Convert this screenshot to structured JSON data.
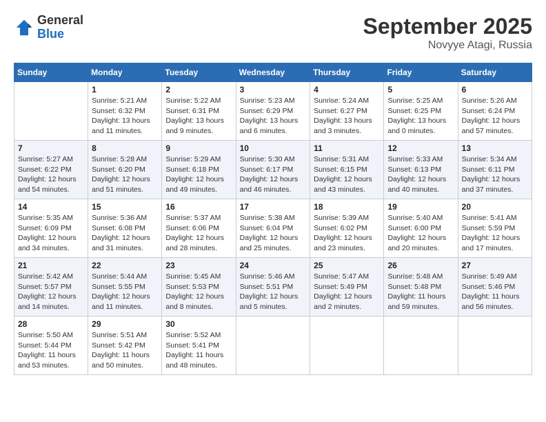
{
  "header": {
    "logo": {
      "general": "General",
      "blue": "Blue"
    },
    "title": "September 2025",
    "location": "Novyye Atagi, Russia"
  },
  "columns": [
    "Sunday",
    "Monday",
    "Tuesday",
    "Wednesday",
    "Thursday",
    "Friday",
    "Saturday"
  ],
  "weeks": [
    [
      {
        "num": "",
        "info": ""
      },
      {
        "num": "1",
        "info": "Sunrise: 5:21 AM\nSunset: 6:32 PM\nDaylight: 13 hours\nand 11 minutes."
      },
      {
        "num": "2",
        "info": "Sunrise: 5:22 AM\nSunset: 6:31 PM\nDaylight: 13 hours\nand 9 minutes."
      },
      {
        "num": "3",
        "info": "Sunrise: 5:23 AM\nSunset: 6:29 PM\nDaylight: 13 hours\nand 6 minutes."
      },
      {
        "num": "4",
        "info": "Sunrise: 5:24 AM\nSunset: 6:27 PM\nDaylight: 13 hours\nand 3 minutes."
      },
      {
        "num": "5",
        "info": "Sunrise: 5:25 AM\nSunset: 6:25 PM\nDaylight: 13 hours\nand 0 minutes."
      },
      {
        "num": "6",
        "info": "Sunrise: 5:26 AM\nSunset: 6:24 PM\nDaylight: 12 hours\nand 57 minutes."
      }
    ],
    [
      {
        "num": "7",
        "info": "Sunrise: 5:27 AM\nSunset: 6:22 PM\nDaylight: 12 hours\nand 54 minutes."
      },
      {
        "num": "8",
        "info": "Sunrise: 5:28 AM\nSunset: 6:20 PM\nDaylight: 12 hours\nand 51 minutes."
      },
      {
        "num": "9",
        "info": "Sunrise: 5:29 AM\nSunset: 6:18 PM\nDaylight: 12 hours\nand 49 minutes."
      },
      {
        "num": "10",
        "info": "Sunrise: 5:30 AM\nSunset: 6:17 PM\nDaylight: 12 hours\nand 46 minutes."
      },
      {
        "num": "11",
        "info": "Sunrise: 5:31 AM\nSunset: 6:15 PM\nDaylight: 12 hours\nand 43 minutes."
      },
      {
        "num": "12",
        "info": "Sunrise: 5:33 AM\nSunset: 6:13 PM\nDaylight: 12 hours\nand 40 minutes."
      },
      {
        "num": "13",
        "info": "Sunrise: 5:34 AM\nSunset: 6:11 PM\nDaylight: 12 hours\nand 37 minutes."
      }
    ],
    [
      {
        "num": "14",
        "info": "Sunrise: 5:35 AM\nSunset: 6:09 PM\nDaylight: 12 hours\nand 34 minutes."
      },
      {
        "num": "15",
        "info": "Sunrise: 5:36 AM\nSunset: 6:08 PM\nDaylight: 12 hours\nand 31 minutes."
      },
      {
        "num": "16",
        "info": "Sunrise: 5:37 AM\nSunset: 6:06 PM\nDaylight: 12 hours\nand 28 minutes."
      },
      {
        "num": "17",
        "info": "Sunrise: 5:38 AM\nSunset: 6:04 PM\nDaylight: 12 hours\nand 25 minutes."
      },
      {
        "num": "18",
        "info": "Sunrise: 5:39 AM\nSunset: 6:02 PM\nDaylight: 12 hours\nand 23 minutes."
      },
      {
        "num": "19",
        "info": "Sunrise: 5:40 AM\nSunset: 6:00 PM\nDaylight: 12 hours\nand 20 minutes."
      },
      {
        "num": "20",
        "info": "Sunrise: 5:41 AM\nSunset: 5:59 PM\nDaylight: 12 hours\nand 17 minutes."
      }
    ],
    [
      {
        "num": "21",
        "info": "Sunrise: 5:42 AM\nSunset: 5:57 PM\nDaylight: 12 hours\nand 14 minutes."
      },
      {
        "num": "22",
        "info": "Sunrise: 5:44 AM\nSunset: 5:55 PM\nDaylight: 12 hours\nand 11 minutes."
      },
      {
        "num": "23",
        "info": "Sunrise: 5:45 AM\nSunset: 5:53 PM\nDaylight: 12 hours\nand 8 minutes."
      },
      {
        "num": "24",
        "info": "Sunrise: 5:46 AM\nSunset: 5:51 PM\nDaylight: 12 hours\nand 5 minutes."
      },
      {
        "num": "25",
        "info": "Sunrise: 5:47 AM\nSunset: 5:49 PM\nDaylight: 12 hours\nand 2 minutes."
      },
      {
        "num": "26",
        "info": "Sunrise: 5:48 AM\nSunset: 5:48 PM\nDaylight: 11 hours\nand 59 minutes."
      },
      {
        "num": "27",
        "info": "Sunrise: 5:49 AM\nSunset: 5:46 PM\nDaylight: 11 hours\nand 56 minutes."
      }
    ],
    [
      {
        "num": "28",
        "info": "Sunrise: 5:50 AM\nSunset: 5:44 PM\nDaylight: 11 hours\nand 53 minutes."
      },
      {
        "num": "29",
        "info": "Sunrise: 5:51 AM\nSunset: 5:42 PM\nDaylight: 11 hours\nand 50 minutes."
      },
      {
        "num": "30",
        "info": "Sunrise: 5:52 AM\nSunset: 5:41 PM\nDaylight: 11 hours\nand 48 minutes."
      },
      {
        "num": "",
        "info": ""
      },
      {
        "num": "",
        "info": ""
      },
      {
        "num": "",
        "info": ""
      },
      {
        "num": "",
        "info": ""
      }
    ]
  ]
}
